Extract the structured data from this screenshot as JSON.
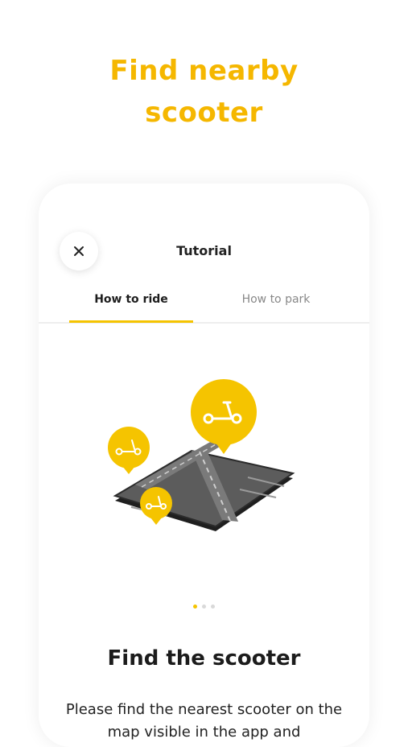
{
  "headline": {
    "line1": "Find nearby",
    "line2": "scooter"
  },
  "nav": {
    "title": "Tutorial"
  },
  "tabs": [
    {
      "label": "How to ride",
      "active": true
    },
    {
      "label": "How to park",
      "active": false
    }
  ],
  "pager": {
    "total": 3,
    "current": 1
  },
  "step": {
    "title": "Find the scooter",
    "description": "Please find the nearest scooter on the map visible in the app and"
  },
  "colors": {
    "accent": "#F5C400",
    "headline": "#F5B700",
    "road": "#6e6e6e",
    "asphalt": "#555555"
  },
  "icons": {
    "close": "close-icon",
    "pins": "scooter-pin-icon"
  }
}
